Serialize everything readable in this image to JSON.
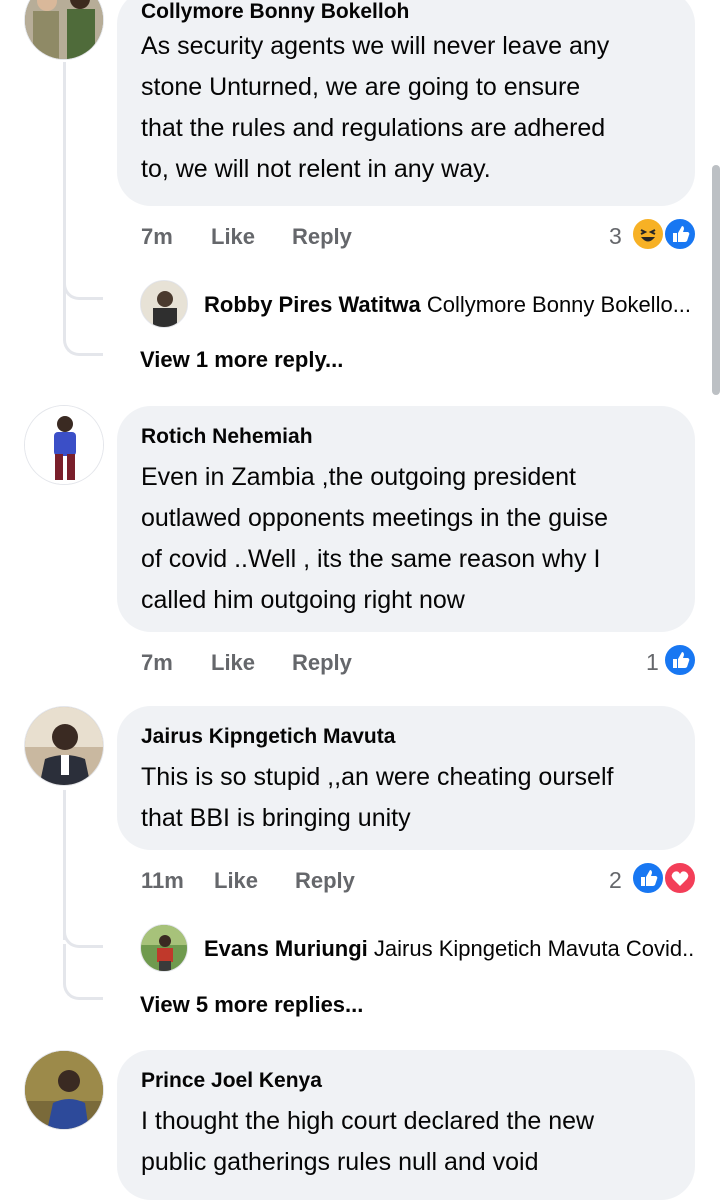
{
  "comments": [
    {
      "author": "Collymore Bonny Bokelloh",
      "lines": [
        "As security agents we will never leave any",
        "stone Unturned, we are going to ensure",
        "that the rules and regulations are adhered",
        "to, we will not relent in any way."
      ],
      "time": "7m",
      "like_label": "Like",
      "reply_label": "Reply",
      "reaction_count": "3",
      "reactions": [
        "haha-icon",
        "like-icon"
      ],
      "reply_preview": {
        "name": "Robby Pires Watitwa",
        "text": "Collymore Bonny Bokello..."
      },
      "view_more": "View 1 more reply..."
    },
    {
      "author": "Rotich Nehemiah",
      "lines": [
        "Even in Zambia ,the outgoing president",
        "outlawed opponents meetings in the guise",
        "of covid ..Well , its the same reason why I",
        "called him outgoing right now"
      ],
      "time": "7m",
      "like_label": "Like",
      "reply_label": "Reply",
      "reaction_count": "1",
      "reactions": [
        "like-icon"
      ]
    },
    {
      "author": "Jairus Kipngetich Mavuta",
      "lines": [
        "This is so stupid ,,an were cheating ourself",
        "that BBI is bringing unity"
      ],
      "time": "11m",
      "like_label": "Like",
      "reply_label": "Reply",
      "reaction_count": "2",
      "reactions": [
        "like-icon",
        "love-icon"
      ],
      "reply_preview": {
        "name": "Evans Muriungi",
        "text": "Jairus Kipngetich Mavuta Covid..."
      },
      "view_more": "View 5 more replies..."
    },
    {
      "author": "Prince Joel Kenya",
      "lines": [
        "I thought the high court declared the new",
        "public gatherings rules null and void"
      ]
    }
  ],
  "colors": {
    "like": "#1877f2",
    "love": "#f33e58",
    "haha": "#f7b125",
    "bubble": "#f0f2f5",
    "meta": "#65676b"
  }
}
